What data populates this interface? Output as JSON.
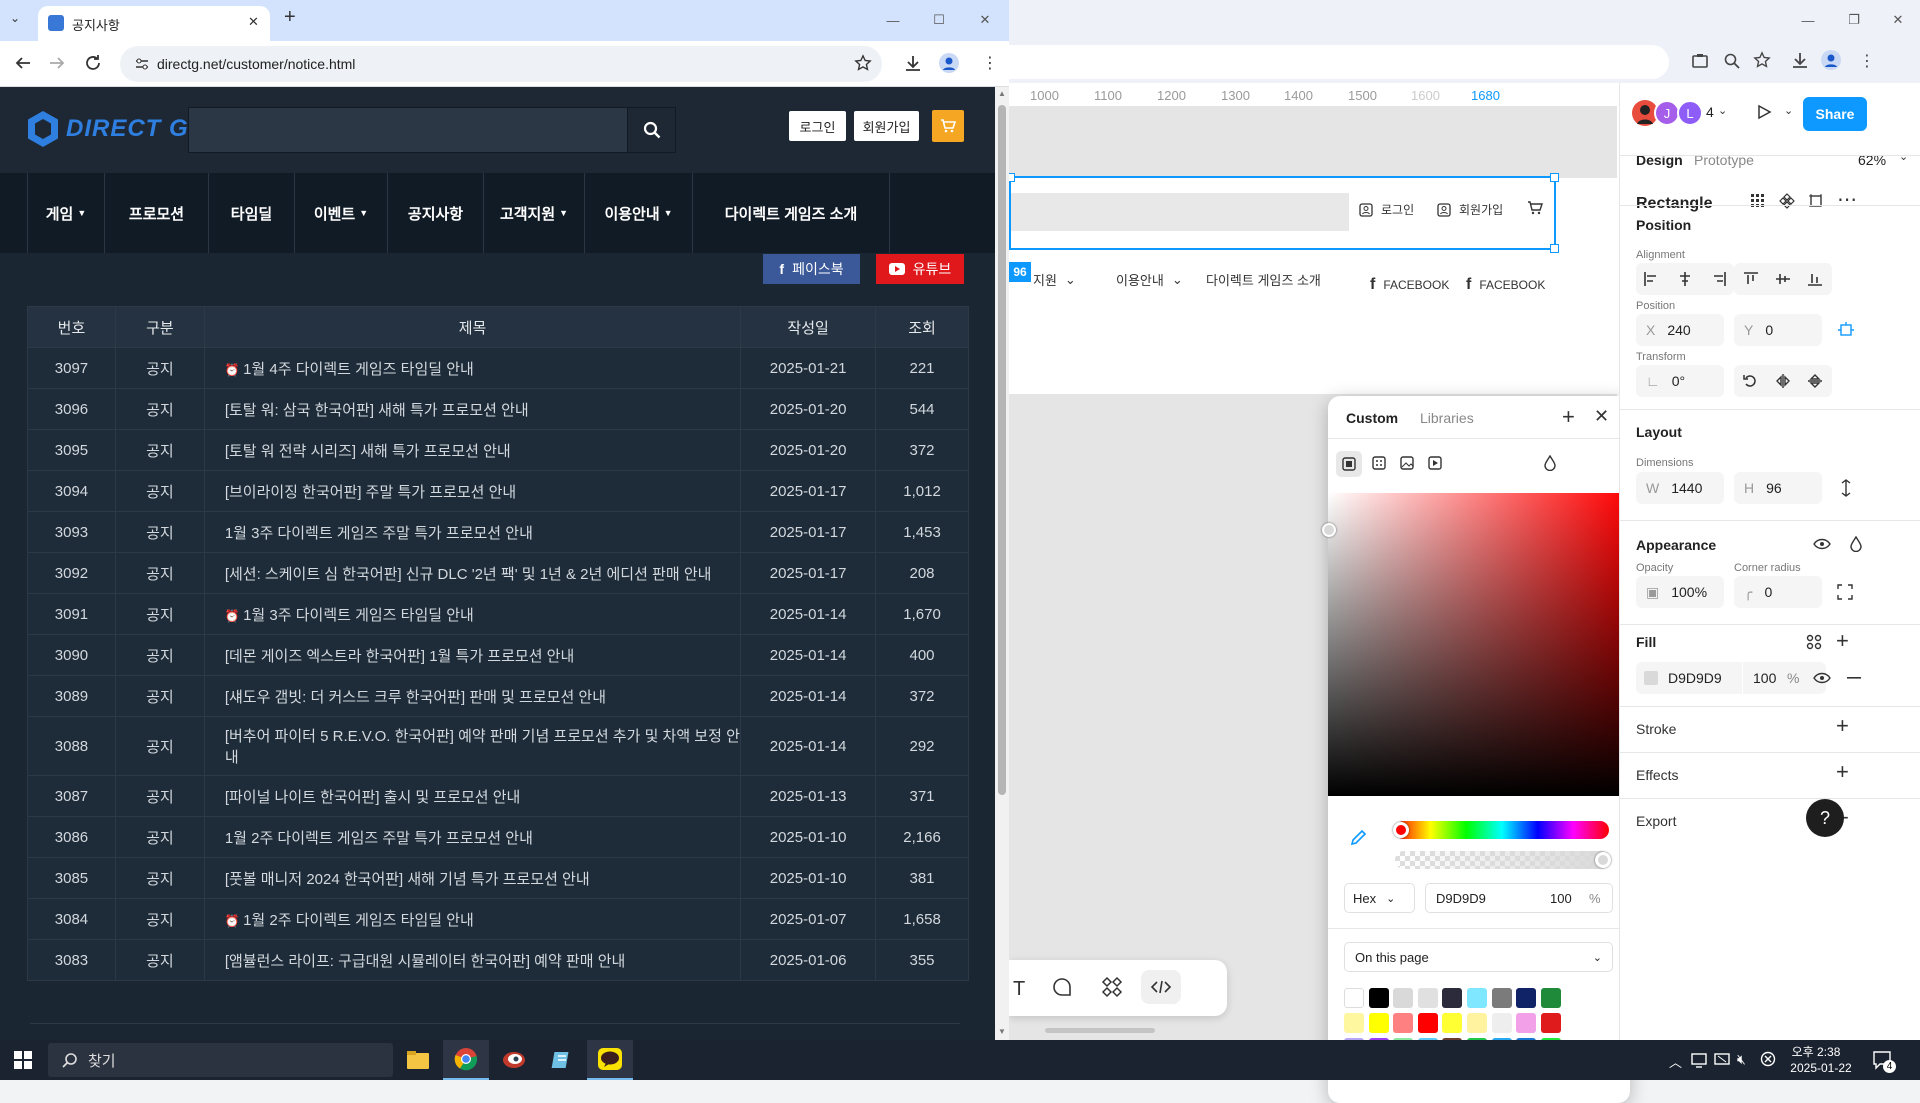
{
  "browser": {
    "tab_title": "공지사항",
    "new_tab": "+",
    "url": "directg.net/customer/notice.html"
  },
  "site": {
    "logo": "DIRECT G",
    "search_placeholder": "",
    "login": "로그인",
    "signup": "회원가입",
    "nav": [
      "게임",
      "프로모션",
      "타임딜",
      "이벤트",
      "공지사항",
      "고객지원",
      "이용안내",
      "다이렉트 게임즈 소개"
    ],
    "nav_dropdown": [
      true,
      false,
      false,
      true,
      false,
      true,
      true,
      false
    ],
    "facebook": "페이스북",
    "youtube": "유튜브",
    "table": {
      "headers": [
        "번호",
        "구분",
        "제목",
        "작성일",
        "조회"
      ],
      "rows": [
        [
          "3097",
          "공지",
          "1월 4주 다이렉트 게임즈 타임딜 안내",
          "2025-01-21",
          "221"
        ],
        [
          "3096",
          "공지",
          "[토탈 워: 삼국 한국어판] 새해 특가 프로모션 안내",
          "2025-01-20",
          "544"
        ],
        [
          "3095",
          "공지",
          "[토탈 워 전략 시리즈] 새해 특가 프로모션 안내",
          "2025-01-20",
          "372"
        ],
        [
          "3094",
          "공지",
          "[브이라이징 한국어판] 주말 특가 프로모션 안내",
          "2025-01-17",
          "1,012"
        ],
        [
          "3093",
          "공지",
          "1월 3주 다이렉트 게임즈 주말 특가 프로모션 안내",
          "2025-01-17",
          "1,453"
        ],
        [
          "3092",
          "공지",
          "[세션: 스케이트 심 한국어판] 신규 DLC '2년 팩' 및 1년 & 2년 에디션 판매 안내",
          "2025-01-17",
          "208"
        ],
        [
          "3091",
          "공지",
          "1월 3주 다이렉트 게임즈 타임딜 안내",
          "2025-01-14",
          "1,670"
        ],
        [
          "3090",
          "공지",
          "[데몬 게이즈 엑스트라 한국어판] 1월 특가 프로모션 안내",
          "2025-01-14",
          "400"
        ],
        [
          "3089",
          "공지",
          "[섀도우 갬빗: 더 커스드 크루 한국어판] 판매 및 프로모션 안내",
          "2025-01-14",
          "372"
        ],
        [
          "3088",
          "공지",
          "[버추어 파이터 5 R.E.V.O. 한국어판] 예약 판매 기념 프로모션 추가 및 차액 보정 안내",
          "2025-01-14",
          "292"
        ],
        [
          "3087",
          "공지",
          "[파이널 나이트 한국어판] 출시 및 프로모션 안내",
          "2025-01-13",
          "371"
        ],
        [
          "3086",
          "공지",
          "1월 2주 다이렉트 게임즈 주말 특가 프로모션 안내",
          "2025-01-10",
          "2,166"
        ],
        [
          "3085",
          "공지",
          "[풋볼 매니저 2024 한국어판] 새해 기념 특가 프로모션 안내",
          "2025-01-10",
          "381"
        ],
        [
          "3084",
          "공지",
          "1월 2주 다이렉트 게임즈 타임딜 안내",
          "2025-01-07",
          "1,658"
        ],
        [
          "3083",
          "공지",
          "[앰뷸런스 라이프: 구급대원 시뮬레이터 한국어판] 예약 판매 안내",
          "2025-01-06",
          "355"
        ]
      ],
      "alarm_rows": [
        0,
        6,
        13
      ]
    }
  },
  "figma": {
    "ruler": [
      "1000",
      "1100",
      "1200",
      "1300",
      "1400",
      "1500",
      "1600",
      "1680"
    ],
    "canvas_login": "로그인",
    "canvas_signup": "회원가입",
    "canvas_nav": [
      "지원",
      "이용안내",
      "다이렉트 게임즈 소개"
    ],
    "canvas_badge": "96",
    "canvas_fb1": "FACEBOOK",
    "canvas_fb2": "FACEBOOK",
    "avatars": [
      "J",
      "L"
    ],
    "avatar_count": "4",
    "share": "Share",
    "tabs": [
      "Design",
      "Prototype"
    ],
    "zoom": "62%",
    "layer_name": "Rectangle",
    "position_title": "Position",
    "alignment_label": "Alignment",
    "position_label": "Position",
    "x_prefix": "X",
    "x": "240",
    "y_prefix": "Y",
    "y": "0",
    "transform_label": "Transform",
    "rotation": "0°",
    "layout_title": "Layout",
    "dimensions_label": "Dimensions",
    "w_prefix": "W",
    "w": "1440",
    "h_prefix": "H",
    "h": "96",
    "appearance_title": "Appearance",
    "opacity_label": "Opacity",
    "opacity": "100%",
    "radius_label": "Corner radius",
    "radius": "0",
    "fill_title": "Fill",
    "fill_hex": "D9D9D9",
    "fill_opacity": "100",
    "fill_pct": "%",
    "stroke_title": "Stroke",
    "effects_title": "Effects",
    "export_title": "Export",
    "help": "?",
    "picker": {
      "tab_custom": "Custom",
      "tab_libraries": "Libraries",
      "format": "Hex",
      "hex": "D9D9D9",
      "alpha": "100",
      "pct": "%",
      "scope": "On this page",
      "swatches": [
        "#ffffff",
        "#000000",
        "#d9d9d9",
        "#e0e0e0",
        "#2b2b3c",
        "#7fe7ff",
        "#7b7b7b",
        "#0f2366",
        "#1f8a3a",
        "#fff7a0",
        "#ffff00",
        "#ff8080",
        "#ff0000",
        "#ffff33",
        "#fff3a0",
        "#eeeeee",
        "#f2a0e8",
        "#e01b1b",
        "#b6a5f5",
        "#9b40f5",
        "#8be8a0",
        "#5cc8f5",
        "#6b3b2e",
        "#20c84a",
        "#26a8f2",
        "#1976d2",
        "#1fe83a"
      ]
    }
  },
  "taskbar": {
    "search": "찾기",
    "time": "오후 2:38",
    "date": "2025-01-22",
    "notif": "4"
  }
}
